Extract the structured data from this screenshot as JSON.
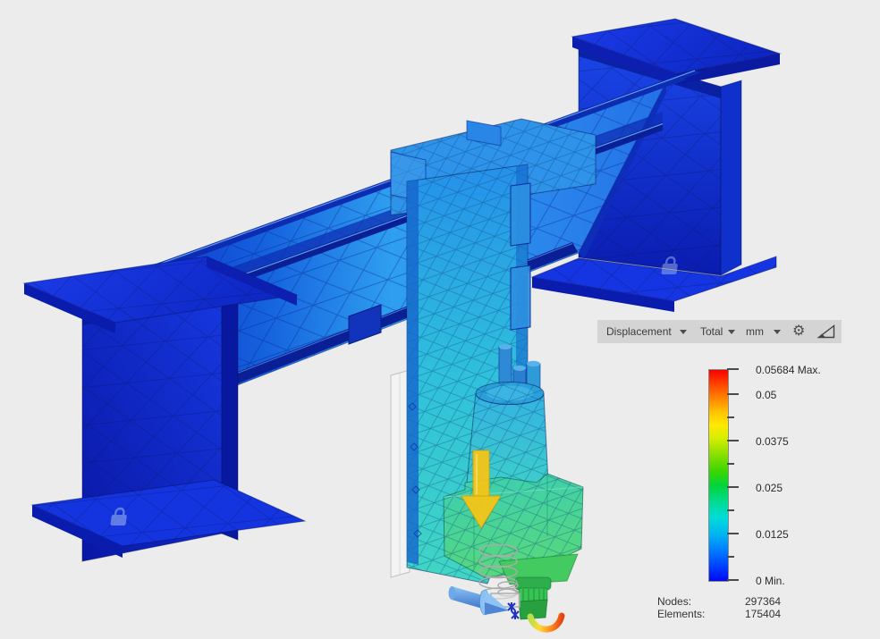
{
  "toolbar": {
    "dropdowns": [
      {
        "name": "result-type",
        "label": "Displacement"
      },
      {
        "name": "result-component",
        "label": "Total"
      },
      {
        "name": "result-unit",
        "label": "mm"
      }
    ],
    "icons": [
      {
        "name": "settings-gear-icon",
        "glyph": "⚙"
      },
      {
        "name": "legend-contour-icon",
        "glyph": "◺"
      },
      {
        "name": "caret-down-icon",
        "glyph": "▼"
      }
    ]
  },
  "legend": {
    "labels": [
      {
        "text": "0.05684 Max.",
        "value": 0.05684
      },
      {
        "text": "0.05",
        "value": 0.05
      },
      {
        "text": "0.0375",
        "value": 0.0375
      },
      {
        "text": "0.025",
        "value": 0.025
      },
      {
        "text": "0.0125",
        "value": 0.0125
      },
      {
        "text": "0 Min.",
        "value": 0
      }
    ],
    "minor_tick_values": [
      0.04375,
      0.03125,
      0.01875,
      0.00625
    ],
    "gradient_colors": [
      "#f60000",
      "#ff8000",
      "#ffe900",
      "#8ae000",
      "#00d43c",
      "#00dcd9",
      "#00b4f0",
      "#0040ff",
      "#0009f2"
    ],
    "orientation": "vertical",
    "max_at": "top"
  },
  "stats": {
    "nodes_label": "Nodes:",
    "nodes_value": "297364",
    "elements_label": "Elements:",
    "elements_value": "175404"
  },
  "result": {
    "quantity": "Displacement",
    "component": "Total",
    "unit": "mm",
    "max": 0.05684,
    "min": 0
  },
  "viewport": {
    "background_color": "#ececec",
    "annotations": [
      {
        "name": "load-arrow-icon",
        "description": "yellow downward load arrow on spindle",
        "color": "#f3c517"
      },
      {
        "name": "force-arrow-icon",
        "description": "blue lateral force arrow at tool tip",
        "color": "#5b9ae6"
      },
      {
        "name": "lock-icon",
        "description": "fixed constraint padlock on left leg foot",
        "color": "#afc4f0"
      },
      {
        "name": "lock-icon",
        "description": "fixed constraint padlock on right leg web",
        "color": "#afc4f0"
      }
    ]
  }
}
